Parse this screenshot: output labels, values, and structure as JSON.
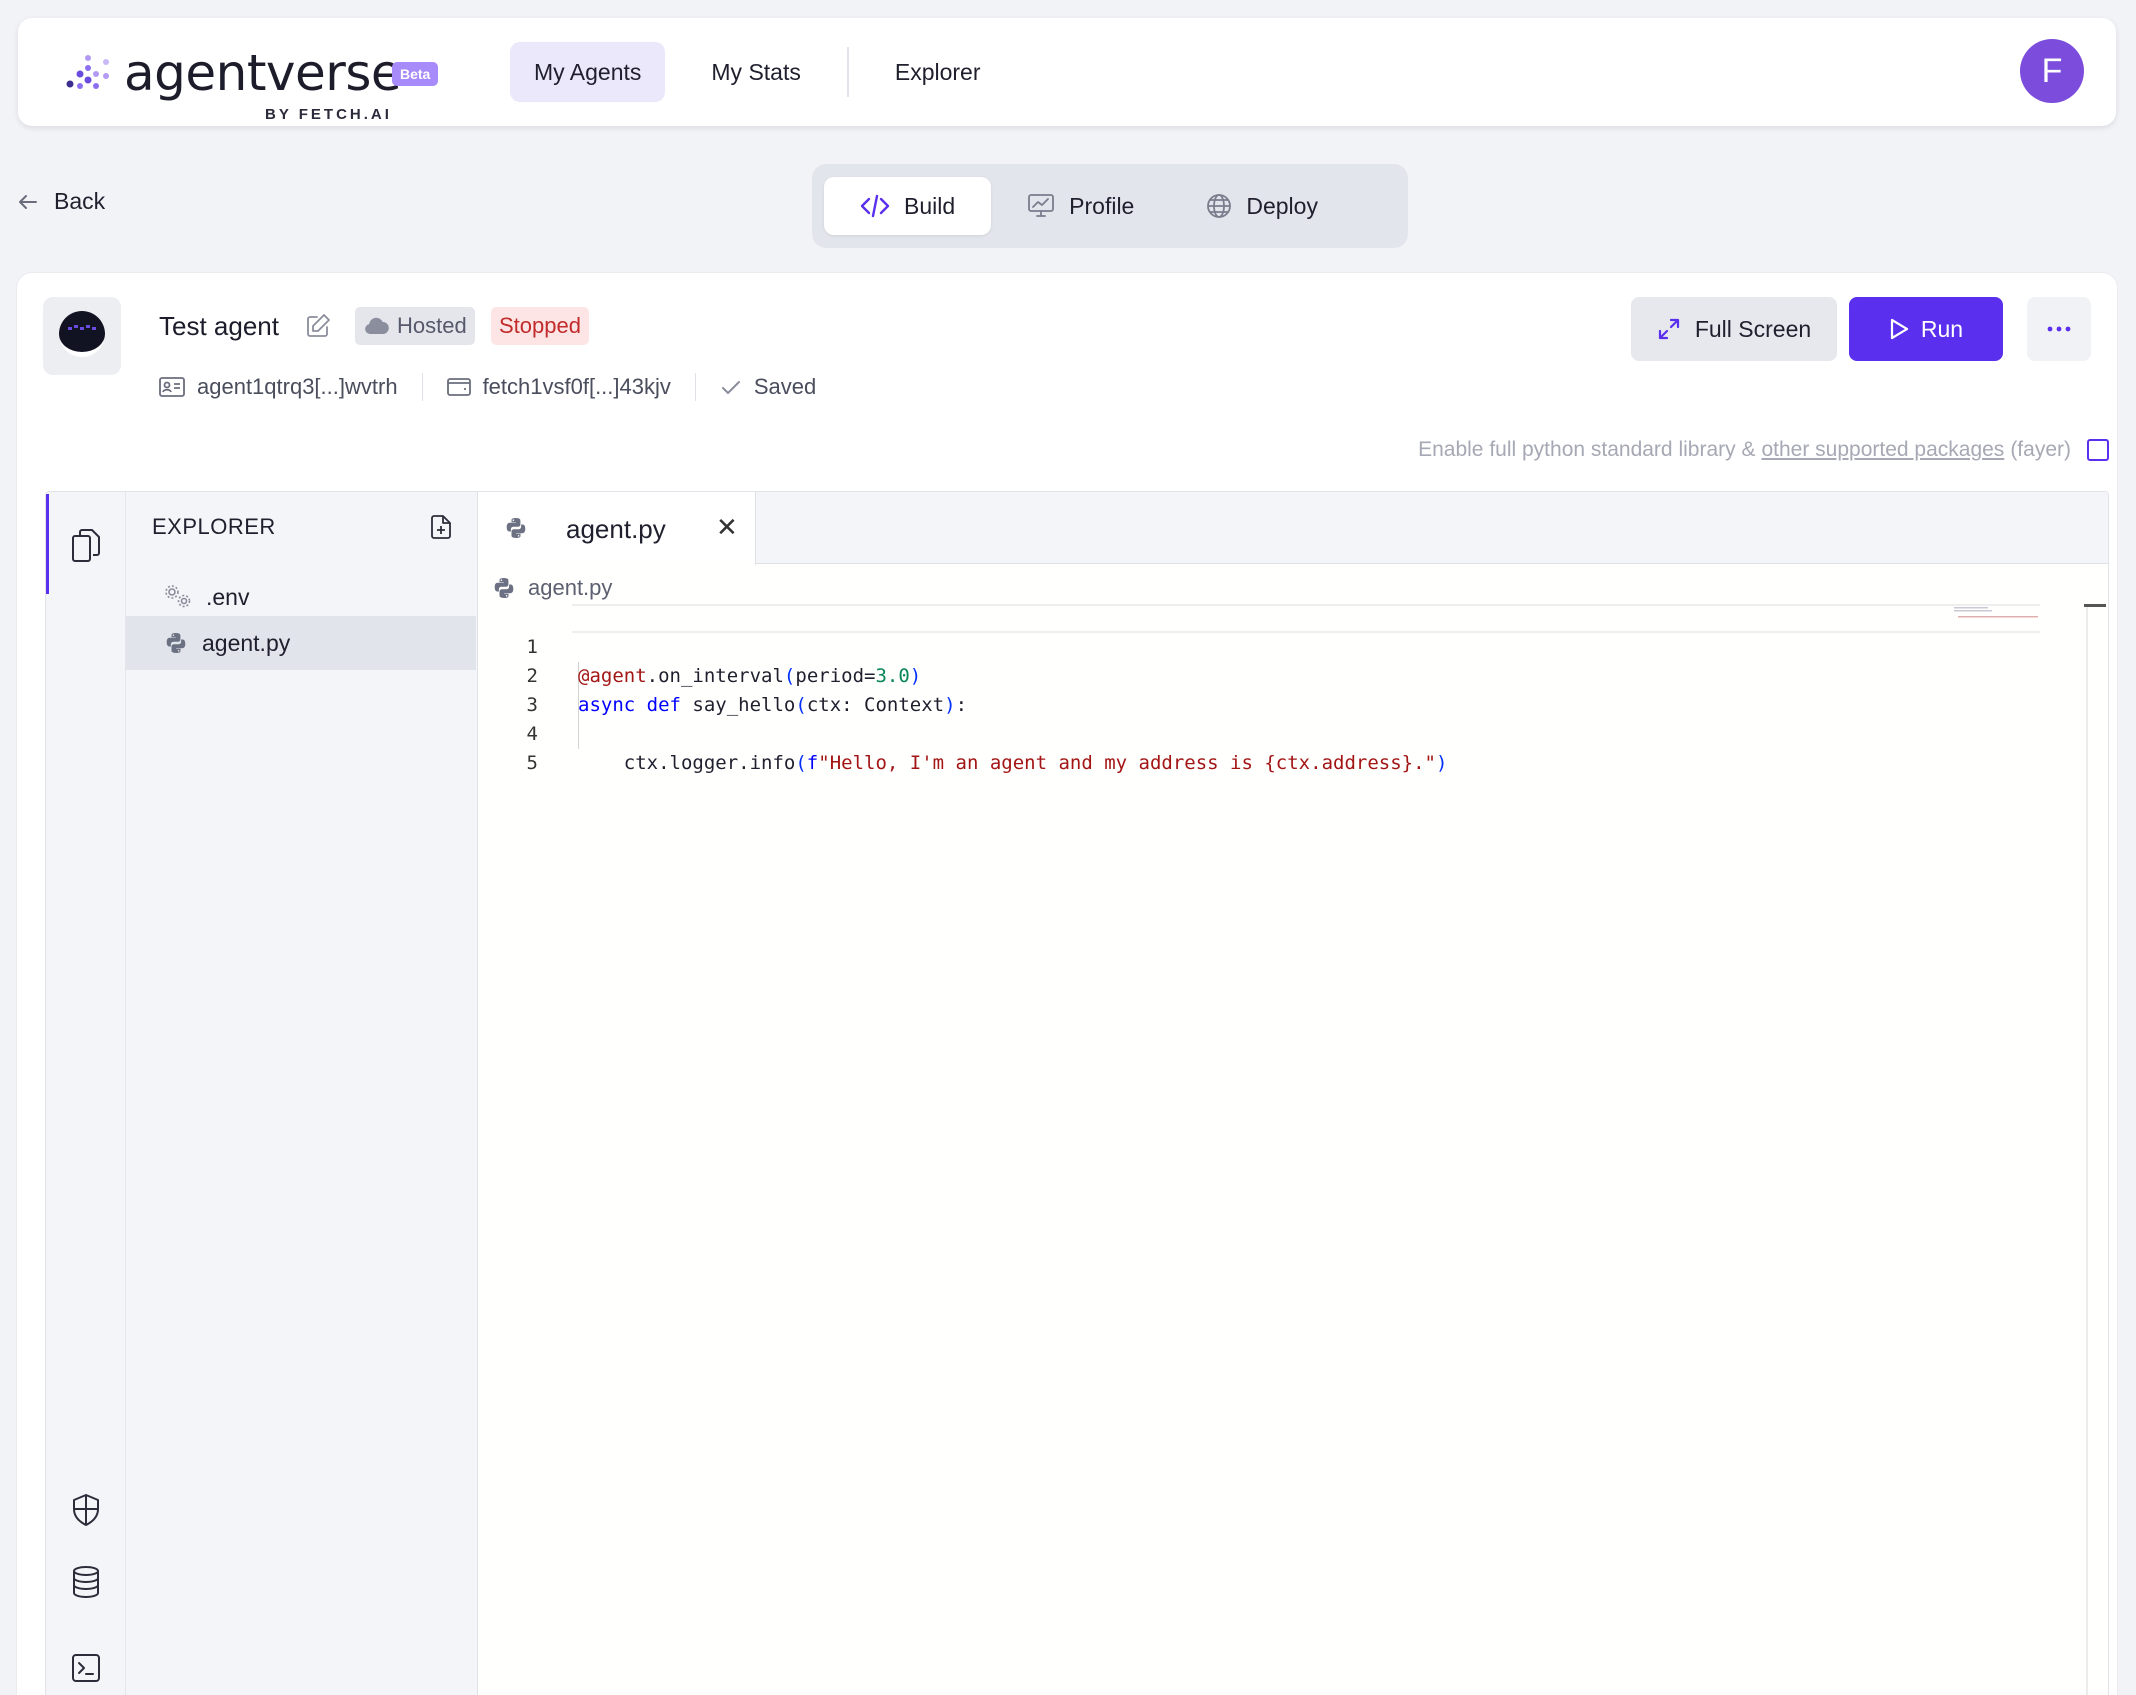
{
  "brand": {
    "name": "agentverse",
    "badge": "Beta",
    "byline": "BY FETCH.AI"
  },
  "nav": {
    "items": [
      "My Agents",
      "My Stats",
      "Explorer"
    ],
    "active": "My Agents"
  },
  "user": {
    "initial": "F",
    "color": "#7c4ddc"
  },
  "back_label": "Back",
  "tabs": {
    "items": [
      "Build",
      "Profile",
      "Deploy"
    ],
    "active": "Build"
  },
  "agent": {
    "name": "Test agent",
    "hosted_label": "Hosted",
    "status": "Stopped",
    "address": "agent1qtrq3[...]wvtrh",
    "wallet": "fetch1vsf0f[...]43kjv",
    "save_state": "Saved"
  },
  "actions": {
    "fullscreen": "Full Screen",
    "run": "Run"
  },
  "stdlib": {
    "text": "Enable full python standard library &",
    "link": "other supported packages",
    "suffix": "(fayer)",
    "checked": false
  },
  "explorer": {
    "title": "EXPLORER",
    "files": [
      ".env",
      "agent.py"
    ],
    "selected": "agent.py"
  },
  "editor": {
    "open_tab": "agent.py",
    "breadcrumb": "agent.py",
    "line_numbers": [
      "1",
      "2",
      "3",
      "4",
      "5"
    ],
    "lines": [
      "@agent.on_interval(period=3.0)",
      "async def say_hello(ctx: Context):",
      "",
      "    ctx.logger.info(f\"Hello, I'm an agent and my address is {ctx.address}.\")",
      ""
    ]
  },
  "colors": {
    "accent": "#5a30ee",
    "stopped": "#c22b2b",
    "avatar": "#7c4ddc"
  }
}
